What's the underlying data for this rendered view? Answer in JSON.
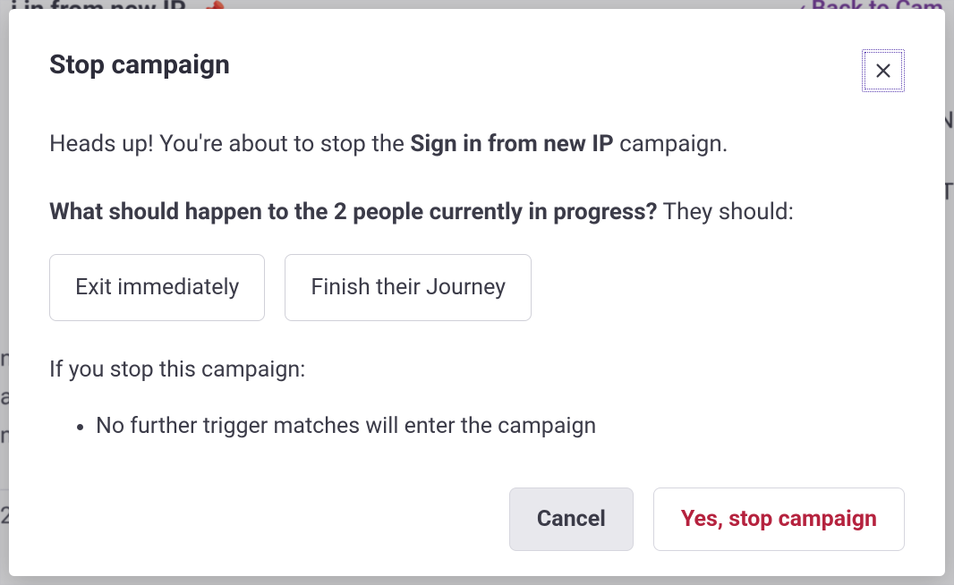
{
  "background": {
    "title_fragment": "i in from new IP",
    "pin_glyph": "📌",
    "back_label": "Back to Cam",
    "side_lines": [
      "ns",
      "at",
      "n"
    ],
    "bottom_fragment": "2",
    "right_letters": [
      "N",
      "T"
    ]
  },
  "modal": {
    "title": "Stop campaign",
    "heads_up_prefix": "Heads up! You're about to stop the ",
    "campaign_name": "Sign in from new IP",
    "heads_up_suffix": " campaign.",
    "question_bold": "What should happen to the 2 people currently in progress?",
    "question_tail": " They should:",
    "options": [
      {
        "label": "Exit immediately"
      },
      {
        "label": "Finish their Journey"
      }
    ],
    "note_intro": "If you stop this campaign:",
    "bullets": [
      "No further trigger matches will enter the campaign"
    ],
    "cancel_label": "Cancel",
    "confirm_label": "Yes, stop campaign"
  }
}
